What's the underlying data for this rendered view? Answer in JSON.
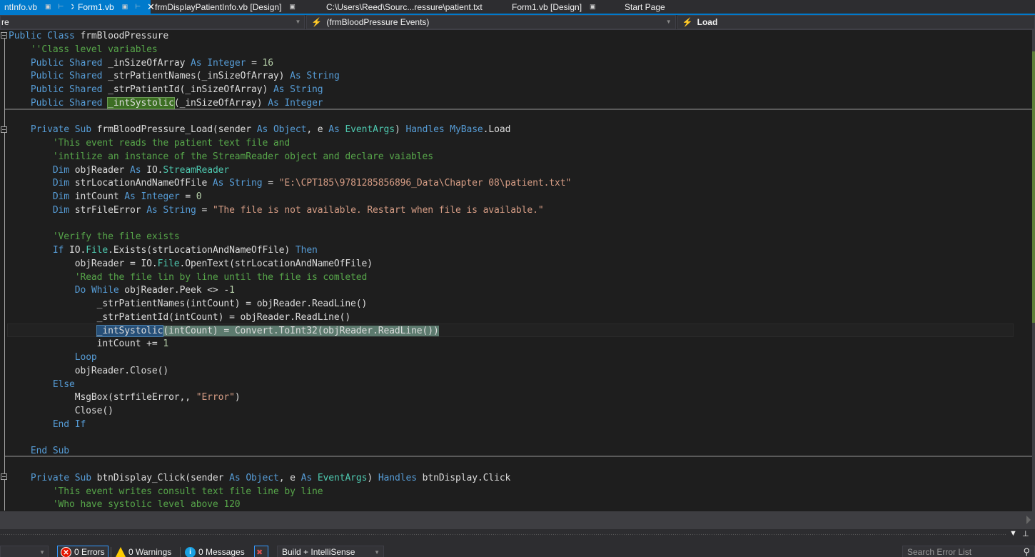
{
  "tabs": [
    {
      "label": "ntInfo.vb",
      "pin": "pin-icon",
      "state": "pinned"
    },
    {
      "label": "Form1.vb",
      "pin": "pin-icon",
      "state": "active"
    },
    {
      "label": "frmDisplayPatientInfo.vb [Design]",
      "state": "normal"
    },
    {
      "label": "C:\\Users\\Reed\\Sourc...ressure\\patient.txt",
      "state": "normal"
    },
    {
      "label": "Form1.vb [Design]",
      "state": "normal"
    },
    {
      "label": "Start Page",
      "state": "normal"
    }
  ],
  "navbar": {
    "project_dropdown": "re",
    "object_dropdown": "(frmBloodPressure Events)",
    "method_dropdown": "Load"
  },
  "code": {
    "lines": [
      "Public Class frmBloodPressure",
      "    ''Class level variables",
      "    Public Shared _inSizeOfArray As Integer = 16",
      "    Public Shared _strPatientNames(_inSizeOfArray) As String",
      "    Public Shared _strPatientId(_inSizeOfArray) As String",
      "    Public Shared _intSystolic(_inSizeOfArray) As Integer",
      "",
      "    Private Sub frmBloodPressure_Load(sender As Object, e As EventArgs) Handles MyBase.Load",
      "        'This event reads the patient text file and",
      "        'intilize an instance of the StreamReader object and declare vaiables",
      "        Dim objReader As IO.StreamReader",
      "        Dim strLocationAndNameOfFile As String = \"E:\\CPT185\\9781285856896_Data\\Chapter 08\\patient.txt\"",
      "        Dim intCount As Integer = 0",
      "        Dim strFileError As String = \"The file is not available. Restart when file is available.\"",
      "",
      "        'Verify the file exists",
      "        If IO.File.Exists(strLocationAndNameOfFile) Then",
      "            objReader = IO.File.OpenText(strLocationAndNameOfFile)",
      "            'Read the file lin by line until the file is comleted",
      "            Do While objReader.Peek <> -1",
      "                _strPatientNames(intCount) = objReader.ReadLine()",
      "                _strPatientId(intCount) = objReader.ReadLine()",
      "                _intSystolic(intCount) = Convert.ToInt32(objReader.ReadLine())",
      "                intCount += 1",
      "            Loop",
      "            objReader.Close()",
      "        Else",
      "            MsgBox(strfileError,, \"Error\")",
      "            Close()",
      "        End If",
      "",
      "    End Sub",
      "",
      "    Private Sub btnDisplay_Click(sender As Object, e As EventArgs) Handles btnDisplay.Click",
      "        'This event writes consult text file line by line",
      "        'Who have systolic level above 120"
    ],
    "highlight_identifier": "_intSystolic",
    "current_line": 23
  },
  "error_list": {
    "errors": "0 Errors",
    "warnings": "0 Warnings",
    "messages": "0 Messages",
    "filter": "Build + IntelliSense",
    "search_placeholder": "Search Error List"
  },
  "colors": {
    "accent": "#007acc",
    "keyword": "#569cd6",
    "type": "#4ec9b0",
    "comment": "#57a64a",
    "string": "#d69d85",
    "number": "#b5cea8"
  }
}
